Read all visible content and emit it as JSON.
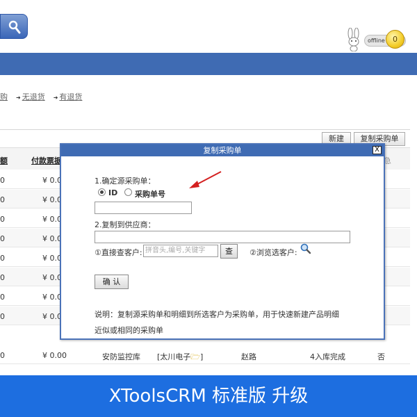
{
  "header": {
    "status": "offline",
    "count": "0"
  },
  "filters": {
    "cut": "购",
    "items": [
      "无退货",
      "有退货"
    ]
  },
  "toolbar": {
    "new_label": "新建",
    "copy_label": "复制采购单"
  },
  "table": {
    "header_cut": "额",
    "header_pay": "付款票据",
    "header_cut_right": "急",
    "rows": [
      {
        "c1": "0",
        "c2": "¥ 0.0"
      },
      {
        "c1": "0",
        "c2": "¥ 0.0"
      },
      {
        "c1": "0",
        "c2": "¥ 0.0"
      },
      {
        "c1": "0",
        "c2": "¥ 0.0"
      },
      {
        "c1": "0",
        "c2": "¥ 0.0"
      },
      {
        "c1": "0",
        "c2": "¥ 0.0"
      },
      {
        "c1": "0",
        "c2": "¥ 0.0"
      },
      {
        "c1": "0",
        "c2": "¥ 0.0"
      }
    ],
    "last_row": {
      "c1": "0",
      "c2": "¥ 0.00",
      "warehouse": "安防监控库",
      "supplier": "[太川电子",
      "supplier_end": "]",
      "person": "赵路",
      "status": "4入库完成",
      "flag": "否"
    }
  },
  "modal": {
    "title": "复制采购单",
    "close": "X",
    "step1": "1.确定源采购单：",
    "radio_id": "ID",
    "radio_no": "采购单号",
    "step2": "2.复制到供应商：",
    "direct_label": "①直接查客户:",
    "search_placeholder": "拼音头,编号,关键字",
    "query_btn": "查",
    "browse_label": "②浏览选客户:",
    "confirm": "确 认",
    "note1": "说明：复制源采购单和明细到所选客户为采购单，用于快速新建产品明细",
    "note2": "近似或相同的采购单"
  },
  "banner": {
    "text": "XToolsCRM 标准版  升级"
  }
}
